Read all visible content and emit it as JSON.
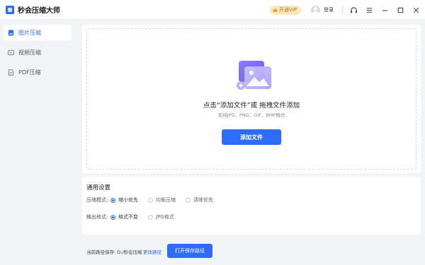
{
  "app": {
    "title": "秒会压缩大师"
  },
  "titlebar": {
    "vip_label": "开通VIP",
    "login_label": "登录"
  },
  "sidebar": {
    "items": [
      {
        "label": "图片压缩",
        "icon": "image-file-icon",
        "active": true
      },
      {
        "label": "视频压缩",
        "icon": "video-icon",
        "active": false
      },
      {
        "label": "PDF压缩",
        "icon": "pdf-file-icon",
        "active": false
      }
    ]
  },
  "dropzone": {
    "title": "点击“添加文件”或 拖拽文件添加",
    "subtitle": "支持JPG、PNG、GIF、BMP格式",
    "add_button": "添加文件"
  },
  "settings": {
    "title": "通用设置",
    "compress_mode": {
      "label": "压缩模式:",
      "options": [
        "缩小优先",
        "均衡压缩",
        "清晰优先"
      ],
      "selected": "缩小优先"
    },
    "output_format": {
      "label": "输出格式:",
      "options": [
        "格式不变",
        "JPG格式"
      ],
      "selected": "格式不变"
    }
  },
  "footer": {
    "path_label": "当前路径保存: D:/秒会压缩",
    "change_path": "更改路径",
    "open_button": "打开保存路径"
  },
  "colors": {
    "accent": "#2f6bff",
    "vip_bg": "#fbe7b8",
    "vip_text": "#b07a1c"
  }
}
